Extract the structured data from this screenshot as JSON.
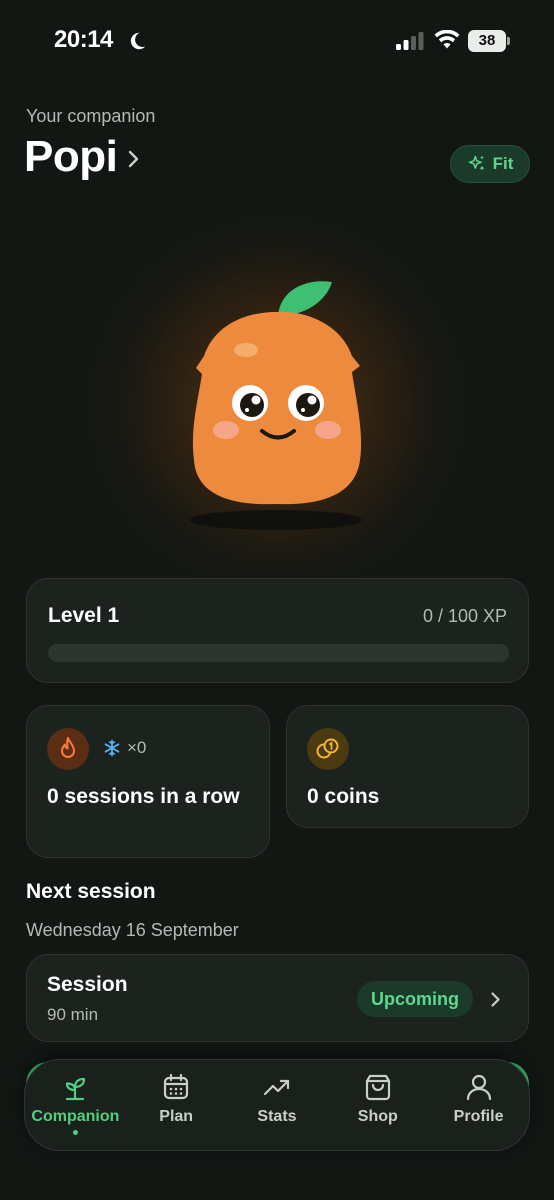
{
  "status_bar": {
    "time": "20:14",
    "battery": "38"
  },
  "header": {
    "companion_label": "Your companion",
    "companion_name": "Popi",
    "fit_label": "Fit"
  },
  "level": {
    "title": "Level 1",
    "xp_text": "0 / 100 XP",
    "progress": 0
  },
  "streak": {
    "freeze_count": "×0",
    "text": "0 sessions in a row"
  },
  "coins": {
    "text": "0 coins"
  },
  "next_session": {
    "title": "Next session",
    "date": "Wednesday 16 September",
    "session_name": "Session",
    "duration": "90 min",
    "status": "Upcoming"
  },
  "nav": {
    "tabs": [
      {
        "label": "Companion",
        "icon": "sprout-icon",
        "active": true
      },
      {
        "label": "Plan",
        "icon": "calendar-icon",
        "active": false
      },
      {
        "label": "Stats",
        "icon": "trend-up-icon",
        "active": false
      },
      {
        "label": "Shop",
        "icon": "shopping-bag-icon",
        "active": false
      },
      {
        "label": "Profile",
        "icon": "person-icon",
        "active": false
      }
    ]
  },
  "colors": {
    "accent": "#4fcf80",
    "background": "#121714",
    "card": "#1c221e",
    "mascot": "#ee8a3e"
  }
}
